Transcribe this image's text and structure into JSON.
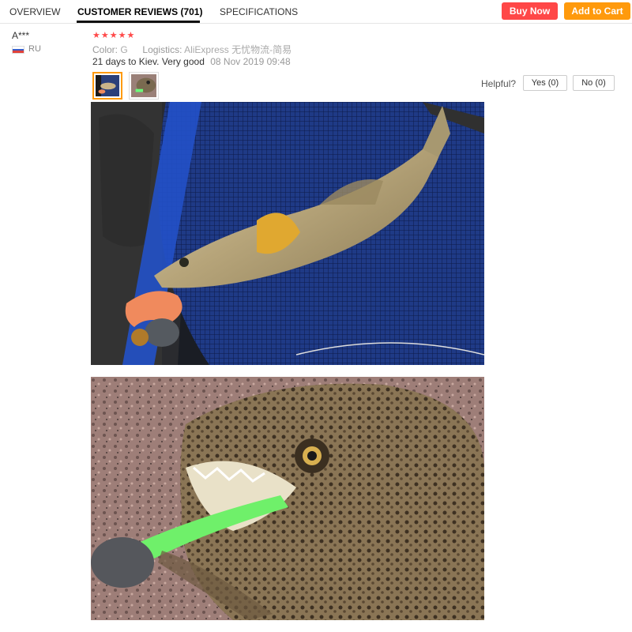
{
  "tabs": {
    "overview": "OVERVIEW",
    "reviews": "CUSTOMER REVIEWS (701)",
    "specifications": "SPECIFICATIONS"
  },
  "actions": {
    "buy_now": "Buy Now",
    "add_to_cart": "Add to Cart"
  },
  "review": {
    "reviewer": "A***",
    "country": "RU",
    "rating": 5,
    "stars": "★★★★★",
    "color_label": "Color:",
    "color_value": "G",
    "logistics_label": "Logistics:",
    "logistics_value": "AliExpress 无忧物流-简易",
    "text": "21 days to Kiev. Very good",
    "date": "08 Nov 2019 09:48",
    "helpful_label": "Helpful?",
    "yes": "Yes (0)",
    "no": "No (0)"
  },
  "colors": {
    "buy_now": "#ff4747",
    "add_to_cart": "#ff9a0c",
    "stars": "#ff4a4a"
  }
}
